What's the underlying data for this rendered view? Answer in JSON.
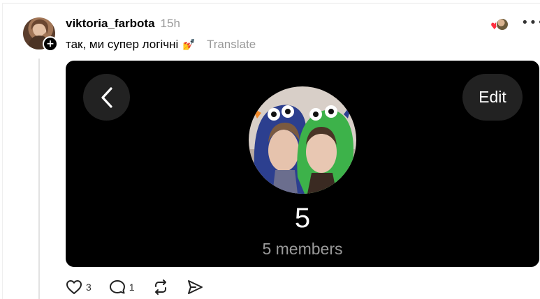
{
  "post": {
    "username": "viktoria_farbota",
    "time": "15h",
    "caption": "так, ми супер логічні",
    "caption_emoji": "💅",
    "translate_label": "Translate",
    "more_label": "•••"
  },
  "group_card": {
    "edit_label": "Edit",
    "group_name": "5",
    "members_label": "5 members"
  },
  "actions": {
    "likes": "3",
    "comments": "1"
  },
  "colors": {
    "like_heart": "#ff3040",
    "card_bg": "#000000",
    "muted": "#999999"
  },
  "icons": [
    "plus-icon",
    "heart-icon",
    "comment-icon",
    "repost-icon",
    "share-icon",
    "chevron-left-icon",
    "more-icon"
  ]
}
